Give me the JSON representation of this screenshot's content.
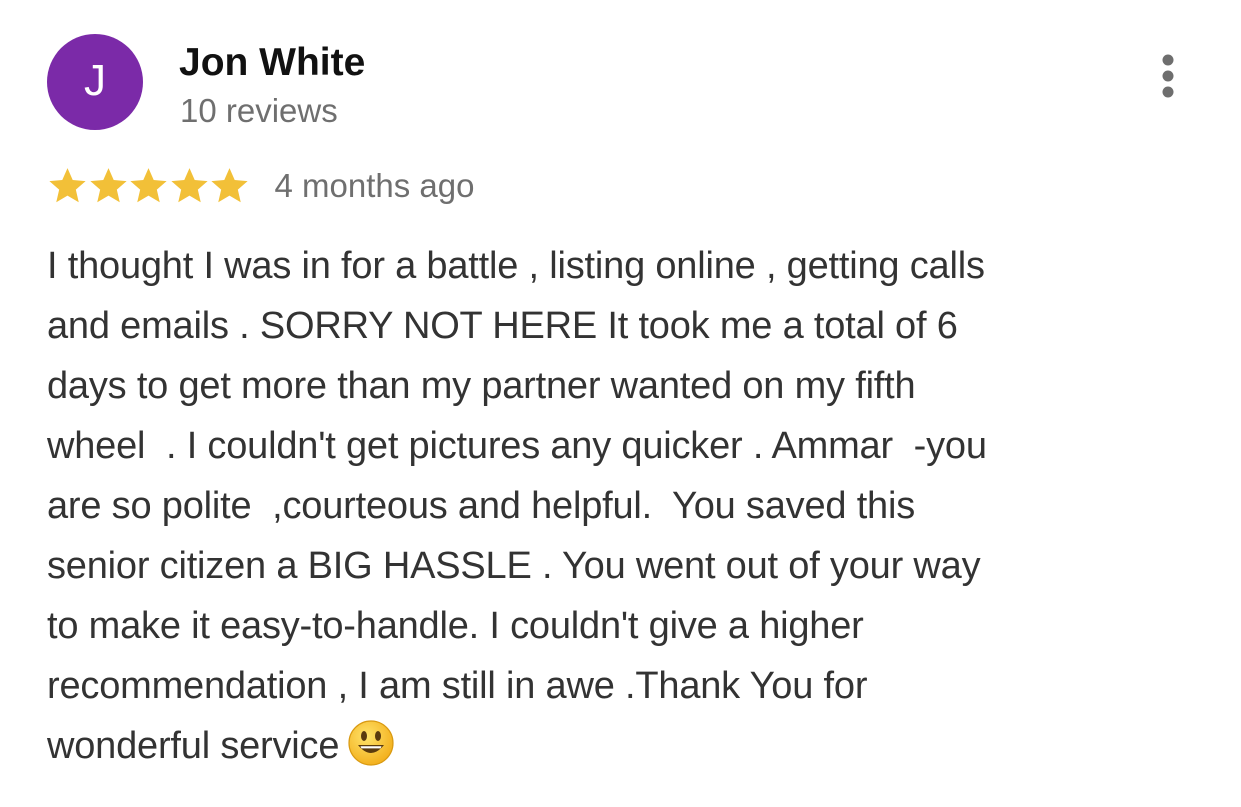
{
  "review": {
    "reviewer": {
      "initial": "J",
      "name": "Jon White",
      "review_count": "10 reviews",
      "avatar_color": "#7b2aa8"
    },
    "more_options_icon": "more-vertical-icon",
    "rating": {
      "stars": 5,
      "max_stars": 5,
      "star_color": "#f2c038"
    },
    "time_ago": "4 months ago",
    "text_lines": [
      "I thought I was in for a battle , listing online , getting calls",
      "and emails . SORRY NOT HERE It took me a total of 6",
      "days to get more than my partner wanted on my fifth",
      "wheel  . I couldn't get pictures any quicker . Ammar  -you",
      "are so polite  ,courteous and helpful.  You saved this",
      "senior citizen a BIG HASSLE . You went out of your way",
      "to make it easy-to-handle. I couldn't give a higher",
      "recommendation , I am still in awe .Thank You for",
      "wonderful service"
    ],
    "trailing_emoji": "smiling-face-emoji"
  }
}
